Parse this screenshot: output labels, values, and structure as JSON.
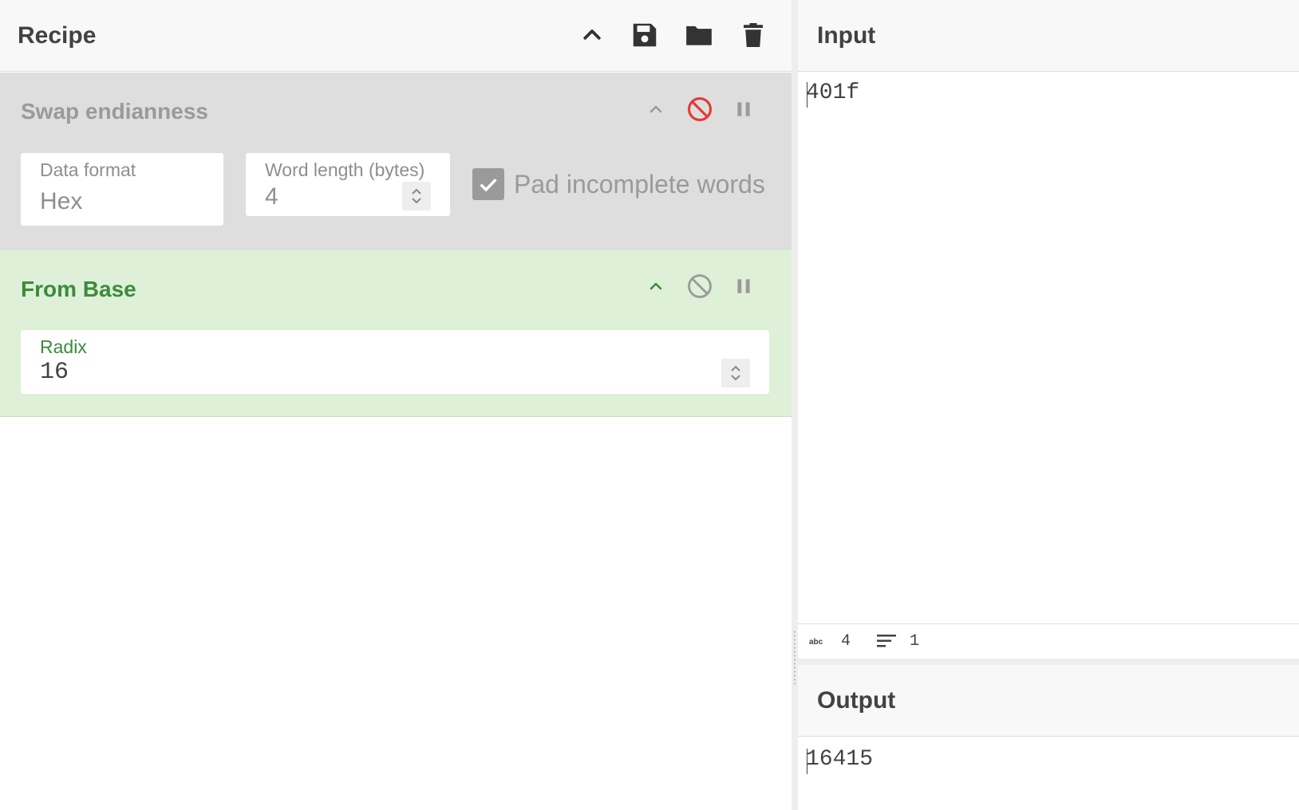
{
  "recipe": {
    "title": "Recipe",
    "operations": [
      {
        "name": "Swap endianness",
        "state": "disabled",
        "fields": [
          {
            "label": "Data format",
            "value": "Hex"
          },
          {
            "label": "Word length (bytes)",
            "value": "4"
          }
        ],
        "checkbox": {
          "label": "Pad incomplete words",
          "checked": true
        }
      },
      {
        "name": "From Base",
        "state": "enabled",
        "fields": [
          {
            "label": "Radix",
            "value": "16"
          }
        ]
      }
    ]
  },
  "input": {
    "title": "Input",
    "text": "401f",
    "status": {
      "length": "4",
      "lines": "1"
    }
  },
  "output": {
    "title": "Output",
    "text": "16415"
  },
  "colors": {
    "disabled_icon": "#e53935",
    "from_base_green": "#3c8b3c",
    "disabled_op_bg": "#dedede",
    "enabled_op_bg": "#dff0d8"
  }
}
